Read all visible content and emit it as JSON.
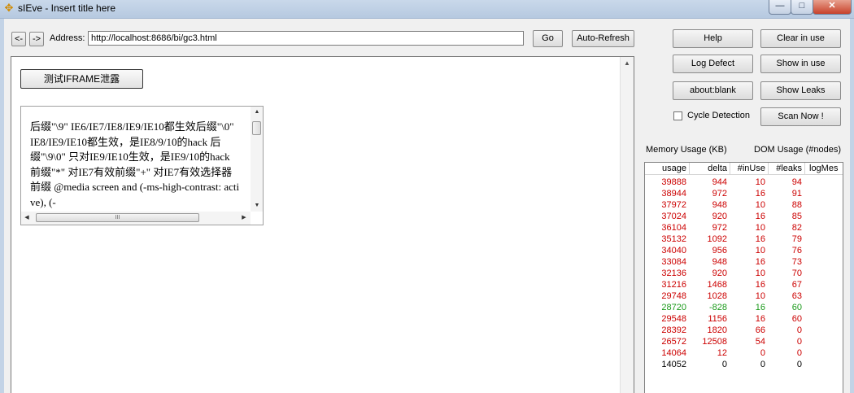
{
  "window": {
    "title": "sIEve - Insert title here",
    "controls": {
      "minimize": "—",
      "maximize": "□",
      "close": "✕"
    }
  },
  "toolbar": {
    "back_label": "<-",
    "forward_label": "->",
    "address_label": "Address:",
    "address_value": "http://localhost:8686/bi/gc3.html",
    "go_label": "Go",
    "autorefresh_label": "Auto-Refresh"
  },
  "page": {
    "iframe_button_label": "测试IFRAME泄露",
    "iframe_text": "后缀\"\\9\" IE6/IE7/IE8/IE9/IE10都生效后缀\"\\0\" IE8/IE9/IE10都生效，是IE8/9/10的hack 后缀\"\\9\\0\" 只对IE9/IE10生效，是IE9/10的hack 前缀\"*\" 对IE7有效前缀\"+\" 对IE7有效选择器前缀 @media screen and (-ms-high-contrast: active), (-",
    "hscroll_grip": "III"
  },
  "side": {
    "help_label": "Help",
    "clear_label": "Clear in use",
    "logdefect_label": "Log Defect",
    "show_label": "Show in use",
    "aboutblank_label": "about:blank",
    "showleaks_label": "Show Leaks",
    "cycle_label": "Cycle Detection",
    "cycle_checked": false,
    "scannow_label": "Scan Now !",
    "memory_label": "Memory Usage (KB)",
    "dom_label": "DOM Usage (#nodes)"
  },
  "table": {
    "headers": [
      "usage",
      "delta",
      "#inUse",
      "#leaks",
      "logMes"
    ],
    "colors": {
      "red": "#cc0000",
      "green": "#1a9a1a",
      "black": "#000000"
    },
    "rows": [
      {
        "usage": "39888",
        "delta": "944",
        "inUse": "10",
        "leaks": "94",
        "color": "red"
      },
      {
        "usage": "38944",
        "delta": "972",
        "inUse": "16",
        "leaks": "91",
        "color": "red"
      },
      {
        "usage": "37972",
        "delta": "948",
        "inUse": "10",
        "leaks": "88",
        "color": "red"
      },
      {
        "usage": "37024",
        "delta": "920",
        "inUse": "16",
        "leaks": "85",
        "color": "red"
      },
      {
        "usage": "36104",
        "delta": "972",
        "inUse": "10",
        "leaks": "82",
        "color": "red"
      },
      {
        "usage": "35132",
        "delta": "1092",
        "inUse": "16",
        "leaks": "79",
        "color": "red"
      },
      {
        "usage": "34040",
        "delta": "956",
        "inUse": "10",
        "leaks": "76",
        "color": "red"
      },
      {
        "usage": "33084",
        "delta": "948",
        "inUse": "16",
        "leaks": "73",
        "color": "red"
      },
      {
        "usage": "32136",
        "delta": "920",
        "inUse": "10",
        "leaks": "70",
        "color": "red"
      },
      {
        "usage": "31216",
        "delta": "1468",
        "inUse": "16",
        "leaks": "67",
        "color": "red"
      },
      {
        "usage": "29748",
        "delta": "1028",
        "inUse": "10",
        "leaks": "63",
        "color": "red"
      },
      {
        "usage": "28720",
        "delta": "-828",
        "inUse": "16",
        "leaks": "60",
        "color": "green"
      },
      {
        "usage": "29548",
        "delta": "1156",
        "inUse": "16",
        "leaks": "60",
        "color": "red"
      },
      {
        "usage": "28392",
        "delta": "1820",
        "inUse": "66",
        "leaks": "0",
        "color": "red"
      },
      {
        "usage": "26572",
        "delta": "12508",
        "inUse": "54",
        "leaks": "0",
        "color": "red"
      },
      {
        "usage": "14064",
        "delta": "12",
        "inUse": "0",
        "leaks": "0",
        "color": "red"
      },
      {
        "usage": "14052",
        "delta": "0",
        "inUse": "0",
        "leaks": "0",
        "color": "black"
      }
    ]
  }
}
